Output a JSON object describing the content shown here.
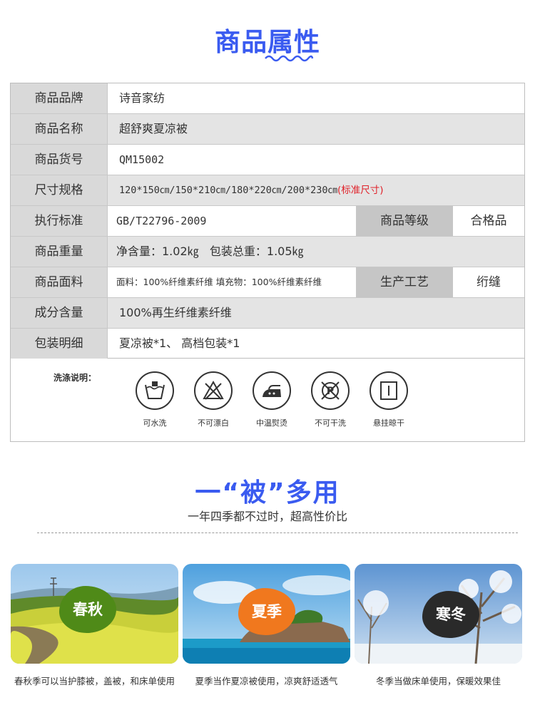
{
  "heading": {
    "title": "商品属性"
  },
  "attributes": {
    "brand": {
      "label": "商品品牌",
      "value": "诗音家纺"
    },
    "name": {
      "label": "商品名称",
      "value": "超舒爽夏凉被"
    },
    "sku": {
      "label": "商品货号",
      "value": "QM15002"
    },
    "size": {
      "label": "尺寸规格",
      "value": "120*150㎝/150*210㎝/180*220㎝/200*230㎝",
      "note": "(标准尺寸)"
    },
    "standard": {
      "label": "执行标准",
      "value": "GB/T22796-2009",
      "label2": "商品等级",
      "value2": "合格品"
    },
    "weight": {
      "label": "商品重量",
      "value": "净含量：1.02㎏   包装总重：1.05㎏"
    },
    "fabric": {
      "label": "商品面料",
      "value": "面料：100%纤维素纤维 填充物：100%纤维素纤维",
      "label2": "生产工艺",
      "value2": "绗缝"
    },
    "composition": {
      "label": "成分含量",
      "value": "100%再生纤维素纤维"
    },
    "package": {
      "label": "包装明细",
      "value": "夏凉被*1、 高档包装*1"
    }
  },
  "washing": {
    "title": "洗涤说明：",
    "items": [
      {
        "icon": "hand-wash-icon",
        "label": "可水洗"
      },
      {
        "icon": "no-bleach-icon",
        "label": "不可漂白"
      },
      {
        "icon": "iron-medium-icon",
        "label": "中温熨烫"
      },
      {
        "icon": "no-dry-clean-icon",
        "label": "不可干洗"
      },
      {
        "icon": "hang-dry-icon",
        "label": "悬挂晾干"
      }
    ]
  },
  "uses": {
    "title": "一“被”多用",
    "subtitle": "一年四季都不过时，超高性价比",
    "seasons": [
      {
        "name": "春秋",
        "caption": "春秋季可以当护膝被，盖被，和床单使用",
        "color": "#4f8a18"
      },
      {
        "name": "夏季",
        "caption": "夏季当作夏凉被使用，凉爽舒适透气",
        "color": "#f0781e"
      },
      {
        "name": "寒冬",
        "caption": "冬季当做床单使用，保暖效果佳",
        "color": "#2a2a2a"
      }
    ]
  },
  "colors": {
    "accent": "#3a5bf0",
    "label_bg": "#d9d9d9",
    "note_red": "#e0222a"
  }
}
